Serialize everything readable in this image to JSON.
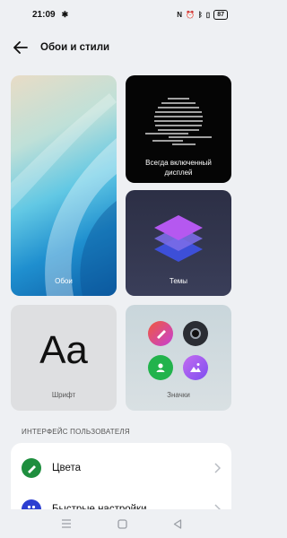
{
  "status_bar": {
    "time": "21:09",
    "battery_level": "87",
    "icons": [
      "gear-icon",
      "nfc-icon",
      "alarm-icon",
      "bluetooth-icon",
      "vibrate-icon",
      "battery-icon"
    ]
  },
  "header": {
    "title": "Обои и стили",
    "back_icon": "arrow-left-icon"
  },
  "tiles": {
    "wallpapers": {
      "label": "Обои"
    },
    "always_on_display": {
      "label_line1": "Всегда включенный",
      "label_line2": "дисплей"
    },
    "themes": {
      "label": "Темы"
    },
    "font": {
      "preview": "Aa",
      "label": "Шрифт"
    },
    "icons": {
      "label": "Значки",
      "app_icons": [
        "brush-icon",
        "camera-icon",
        "contacts-icon",
        "gallery-icon"
      ]
    }
  },
  "ui_section": {
    "title": "ИНТЕРФЕЙС ПОЛЬЗОВАТЕЛЯ",
    "items": [
      {
        "label": "Цвета",
        "icon": "color-palette-icon",
        "icon_color": "#1e8e3e"
      },
      {
        "label": "Быстрые настройки",
        "icon": "quick-settings-icon",
        "icon_color": "#2c3ed1"
      }
    ]
  },
  "nav_bar": {
    "buttons": [
      "menu-icon",
      "home-icon",
      "back-triangle-icon"
    ]
  }
}
